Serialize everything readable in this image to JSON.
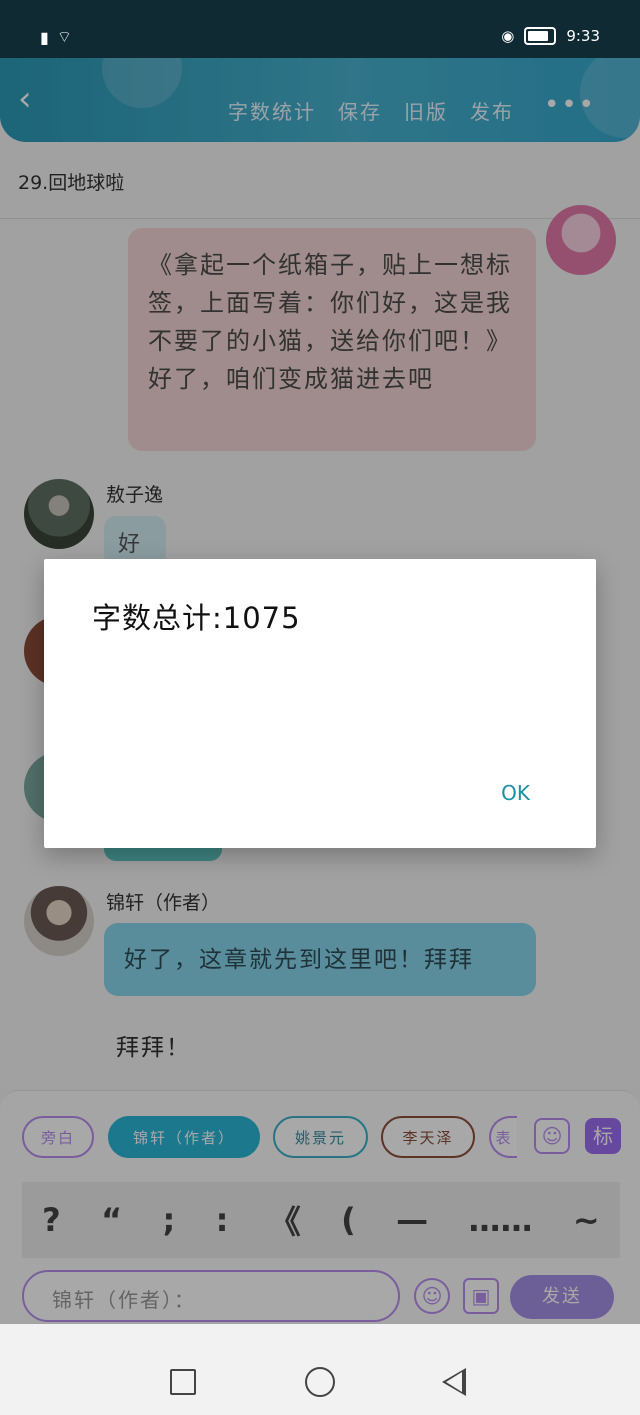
{
  "status_bar": {
    "time": "9:33",
    "icons": [
      "battery-alert-icon",
      "wifi-icon",
      "eye-icon",
      "battery-icon"
    ]
  },
  "header": {
    "back_icon": "back-arrow-icon",
    "actions": [
      "字数统计",
      "保存",
      "旧版",
      "发布"
    ],
    "more_icon": "more-icon",
    "more_label": "•••"
  },
  "chapter": {
    "title": "29.回地球啦"
  },
  "chat": {
    "message_1": "《拿起一个纸箱子，贴上一想标签，上面写着：你们好，这是我不要了的小猫，送给你们吧！》好了，咱们变成猫进去吧",
    "sender_2": "敖子逸",
    "message_2": "好",
    "sender_3": "锦轩（作者）",
    "message_3": "好了，这章就先到这里吧！拜拜",
    "free_text": "拜拜！"
  },
  "composer": {
    "chips": [
      "旁白",
      "锦轩（作者）",
      "姚景元",
      "李天泽",
      "表"
    ],
    "mark_label": "标",
    "punctuation": [
      "?",
      "“",
      ";",
      ":",
      "《",
      "(",
      "—",
      "……",
      "~"
    ],
    "input_placeholder": "锦轩（作者）：",
    "send_label": "发送"
  },
  "dialog": {
    "text": "字数总计:1075",
    "ok_label": "OK"
  },
  "colors": {
    "header_accent": "#2c99b7",
    "purple_accent": "#b88ff0",
    "ok_text": "#1a8fa7"
  }
}
